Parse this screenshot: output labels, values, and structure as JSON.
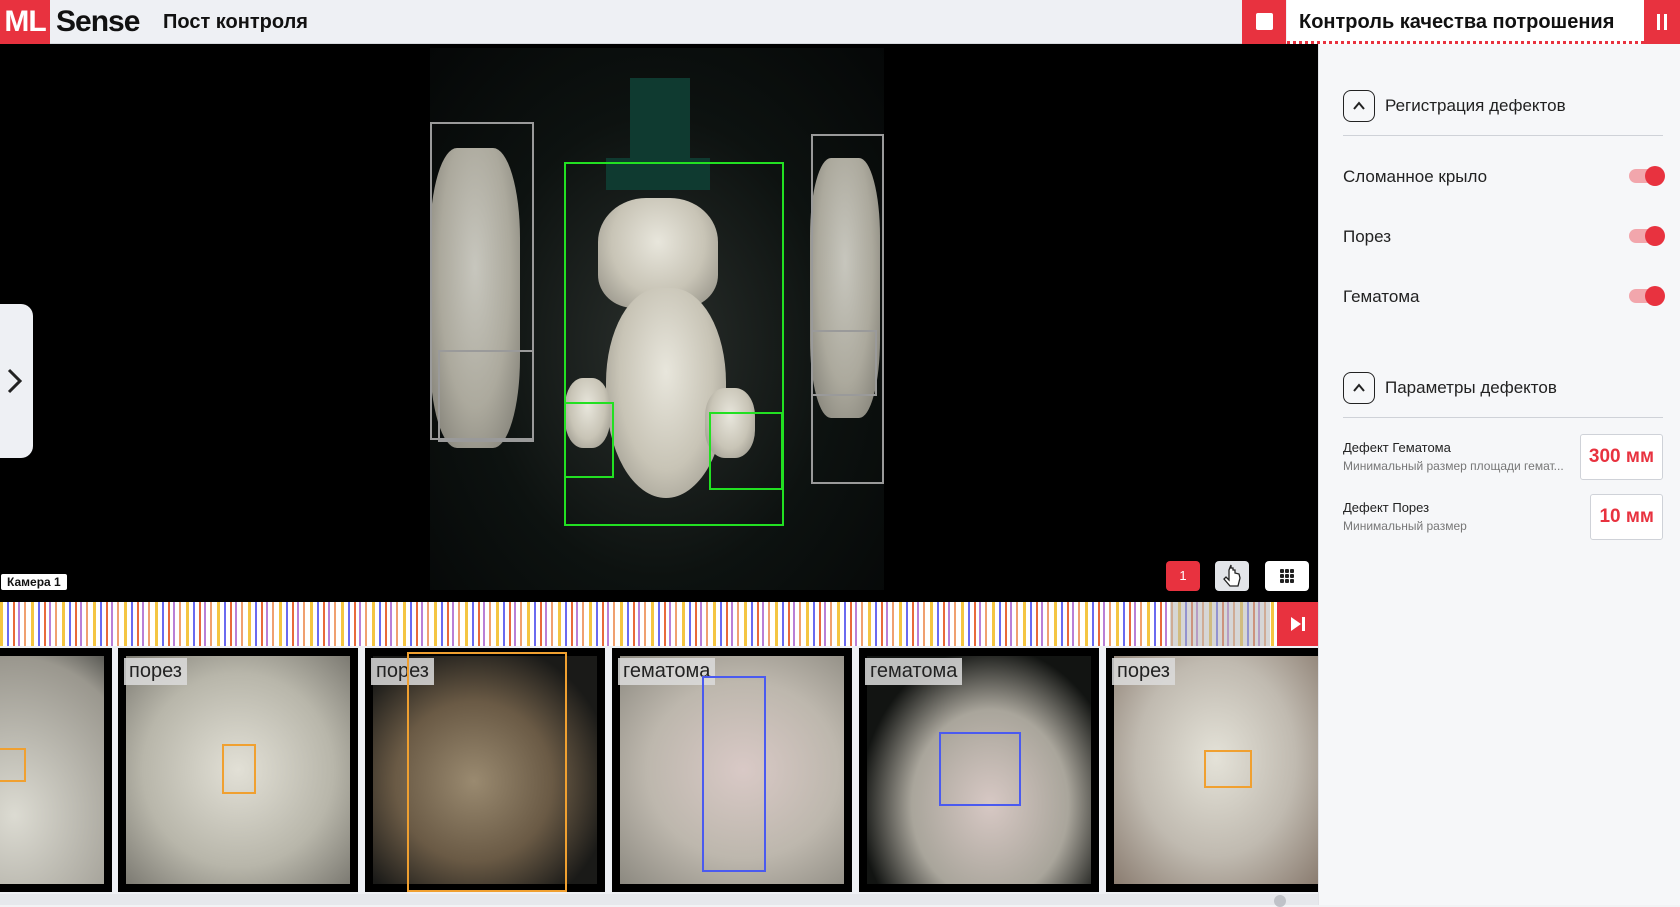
{
  "header": {
    "logo_ml": "ML",
    "logo_sense": "Sense",
    "post_title": "Пост контроля",
    "module_title": "Контроль качества потрошения"
  },
  "viewer": {
    "camera_label": "Камера 1",
    "view_one_label": "1"
  },
  "thumbnails": [
    {
      "label": ""
    },
    {
      "label": "порез"
    },
    {
      "label": "порез"
    },
    {
      "label": "гематома"
    },
    {
      "label": "гематома"
    },
    {
      "label": "порез"
    }
  ],
  "panel": {
    "registration": {
      "title": "Регистрация дефектов",
      "toggles": [
        {
          "label": "Сломанное крыло",
          "on": true
        },
        {
          "label": "Порез",
          "on": true
        },
        {
          "label": "Гематома",
          "on": true
        }
      ]
    },
    "parameters": {
      "title": "Параметры дефектов",
      "items": [
        {
          "title": "Дефект Гематома",
          "subtitle": "Минимальный размер площади гемат...",
          "value": "300 мм"
        },
        {
          "title": "Дефект Порез",
          "subtitle": "Минимальный размер",
          "value": "10 мм"
        }
      ]
    }
  },
  "colors": {
    "accent": "#e8323f",
    "detection_green": "#22e022",
    "detection_orange": "#f0a030",
    "detection_blue": "#4a5af0"
  }
}
